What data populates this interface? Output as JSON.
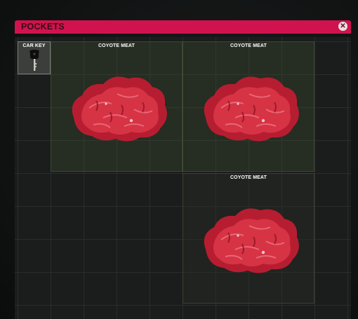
{
  "panel": {
    "title": "POCKETS",
    "close_icon": "close-icon"
  },
  "colors": {
    "titlebar": "#d0134e",
    "grid_background": "#1b1c1c",
    "slot_fill": "#3c4e30",
    "meat": "#c8283a"
  },
  "items": [
    {
      "label": "CAR KEY",
      "icon": "car-key-icon"
    },
    {
      "label": "COYOTE MEAT",
      "icon": "meat-icon"
    },
    {
      "label": "COYOTE MEAT",
      "icon": "meat-icon"
    },
    {
      "label": "COYOTE MEAT",
      "icon": "meat-icon"
    }
  ]
}
